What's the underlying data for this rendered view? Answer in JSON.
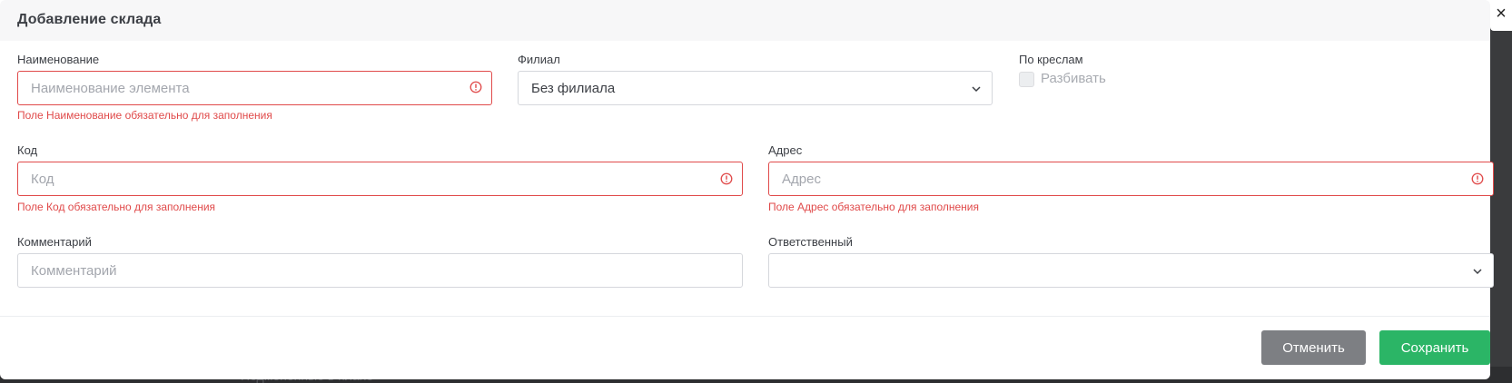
{
  "dialog": {
    "title": "Добавление склада",
    "close_symbol": "×"
  },
  "form": {
    "name": {
      "label": "Наименование",
      "placeholder": "Наименование элемента",
      "value": "",
      "error": "Поле Наименование обязательно для заполнения"
    },
    "branch": {
      "label": "Филиал",
      "selected": "Без филиала"
    },
    "by_chairs": {
      "label": "По креслам",
      "checkbox_label": "Разбивать",
      "checked": false
    },
    "code": {
      "label": "Код",
      "placeholder": "Код",
      "value": "",
      "error": "Поле Код обязательно для заполнения"
    },
    "address": {
      "label": "Адрес",
      "placeholder": "Адрес",
      "value": "",
      "error": "Поле Адрес обязательно для заполнения"
    },
    "comment": {
      "label": "Комментарий",
      "placeholder": "Комментарий",
      "value": ""
    },
    "responsible": {
      "label": "Ответственный",
      "selected": ""
    }
  },
  "footer": {
    "cancel_label": "Отменить",
    "save_label": "Сохранить"
  },
  "colors": {
    "error": "#e04a4a",
    "save": "#2bb566",
    "cancel": "#7d7f83"
  }
}
